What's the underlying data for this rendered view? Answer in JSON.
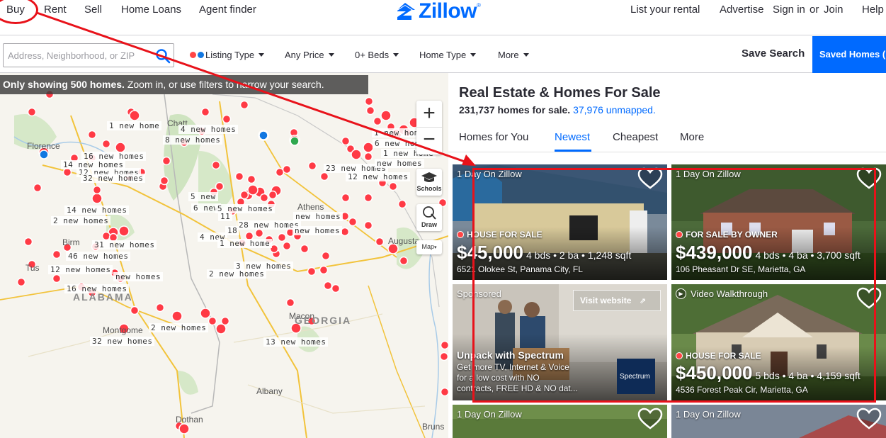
{
  "nav": {
    "left": [
      "Buy",
      "Rent",
      "Sell",
      "Home Loans",
      "Agent finder"
    ],
    "logo": "Zillow",
    "right": {
      "list_rental": "List your rental",
      "advertise": "Advertise",
      "sign_in": "Sign in",
      "or": "or",
      "join": "Join",
      "help": "Help"
    }
  },
  "filters": {
    "search_placeholder": "Address, Neighborhood, or ZIP",
    "listing_type": "Listing Type",
    "price": "Any Price",
    "beds": "0+ Beds",
    "home_type": "Home Type",
    "more": "More",
    "save_search": "Save Search",
    "saved_homes": "Saved Homes (",
    "listing_dot_colors": [
      "#ff4545",
      "#1277e1"
    ]
  },
  "map": {
    "banner_bold": "Only showing 500 homes.",
    "banner_rest": " Zoom in, or use filters to narrow your search.",
    "controls": {
      "zoom_in": "+",
      "zoom_out": "−",
      "schools": "Schools",
      "draw": "Draw",
      "map_type": "Map"
    },
    "states": [
      "ALABAMA",
      "GEORGIA"
    ],
    "places": [
      "Chatt",
      "Florence",
      "Birm",
      "Tus",
      "Montgome",
      "Macon",
      "Albany",
      "Dothan",
      "Augusta",
      "Athens",
      "Bruns"
    ],
    "clusters": [
      "1 new home",
      "4 new homes",
      "8 new homes",
      "16 new homes",
      "14 new homes",
      "12 new homes",
      "32 new homes",
      "5 new",
      "6 new",
      "5 new homes",
      "11",
      "28 new homes",
      "18",
      "new homes",
      "4 new",
      "1 new home",
      "3 new homes",
      "new homes",
      "31 new homes",
      "46 new homes",
      "12 new homes",
      "new homes",
      "16 new homes",
      "2 new homes",
      "14 new homes",
      "2 new homes",
      "2 new homes",
      "32 new homes",
      "13 new homes",
      "23 new homes",
      "6 new home",
      "1 new home",
      "1 new home",
      "12 new homes",
      "new homes"
    ],
    "highway_shields": [
      "59",
      "20",
      "185",
      "75",
      "16",
      "65",
      "75",
      "95"
    ]
  },
  "results": {
    "title": "Real Estate & Homes For Sale",
    "count": "231,737 homes for sale.",
    "unmapped": "37,976 unmapped.",
    "tabs": [
      "Homes for You",
      "Newest",
      "Cheapest",
      "More"
    ],
    "active_tab": "Newest",
    "cards": [
      {
        "tag": "1 Day On Zillow",
        "status": "HOUSE FOR SALE",
        "price": "$45,000",
        "facts": "4 bds • 2 ba • 1,248 sqft",
        "address": "6521 Olokee St, Panama City, FL"
      },
      {
        "tag": "1 Day On Zillow",
        "status": "FOR SALE BY OWNER",
        "price": "$439,000",
        "facts": "4 bds • 4 ba • 3,700 sqft",
        "address": "106 Pheasant Dr SE, Marietta, GA"
      },
      {
        "tag": "Sponsored",
        "ad_title": "Unpack with Spectrum",
        "ad_body_1": "Get more TV, Internet & Voice",
        "ad_body_2": "for a low cost with NO",
        "ad_body_3": "contracts, FREE HD & NO dat...",
        "cta": "Visit website",
        "brand": "Spectrum"
      },
      {
        "tag": "Video Walkthrough",
        "status": "HOUSE FOR SALE",
        "price": "$450,000",
        "facts": "5 bds • 4 ba • 4,159 sqft",
        "address": "4536 Forest Peak Cir, Marietta, GA"
      },
      {
        "tag": "1 Day On Zillow"
      },
      {
        "tag": "1 Day On Zillow"
      }
    ]
  },
  "colors": {
    "brand": "#006aff",
    "marker": "#ff3a45",
    "annotation": "#e8121a"
  }
}
